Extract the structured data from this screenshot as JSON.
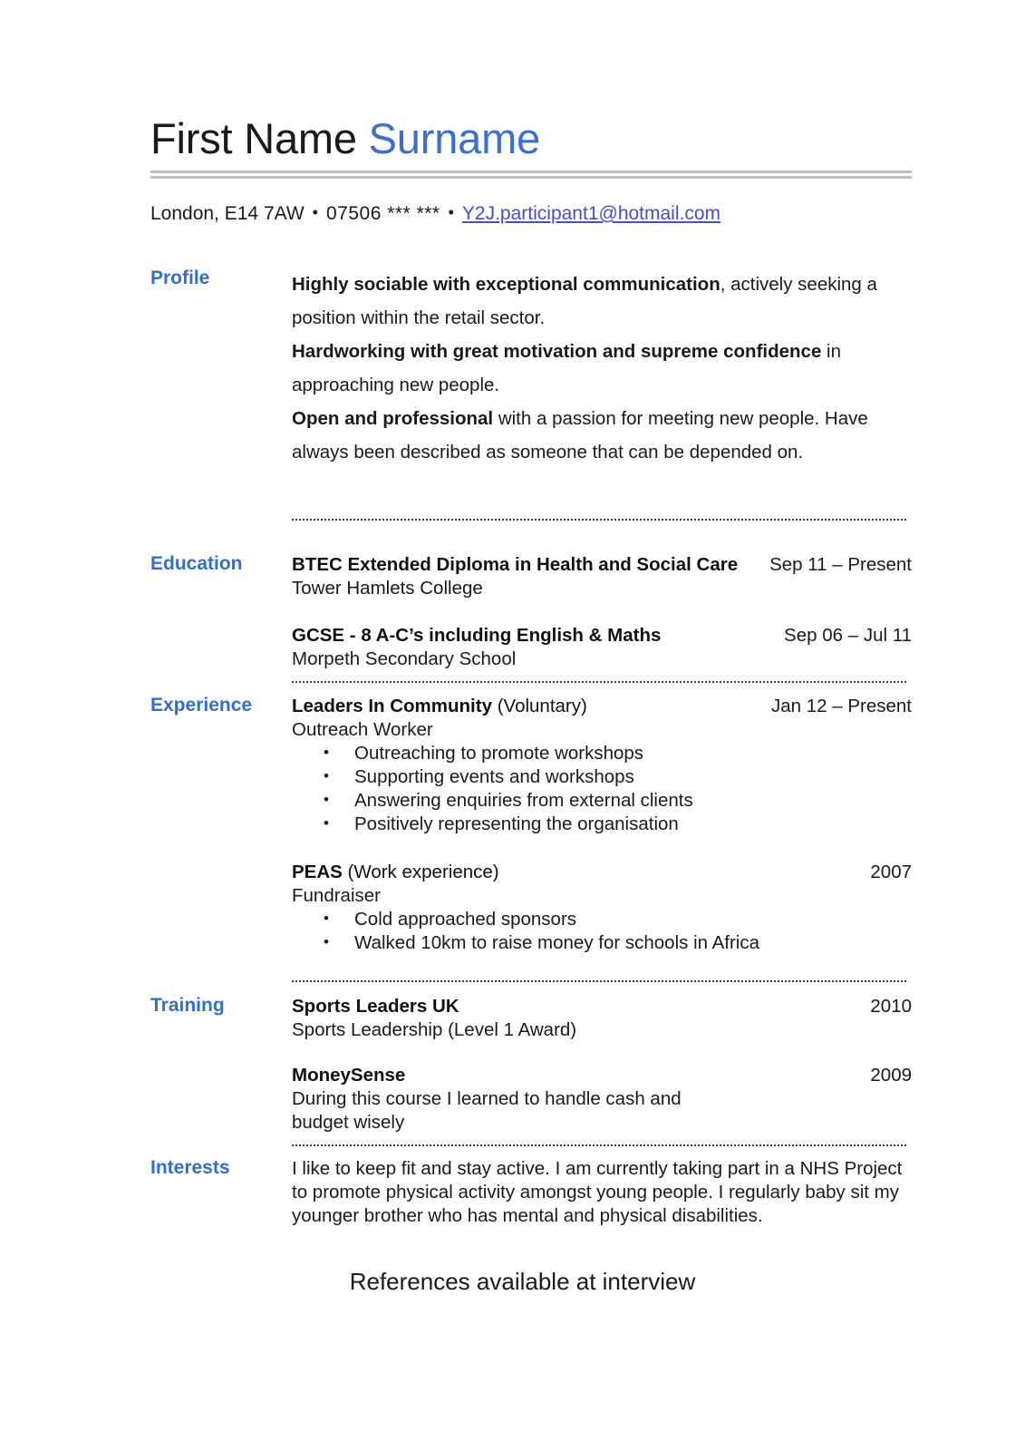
{
  "header": {
    "first_name": "First Name ",
    "surname": "Surname",
    "location": "London, E14 7AW",
    "separator": "•",
    "phone": "07506 *** ***",
    "email": "Y2J.participant1@hotmail.com"
  },
  "colors": {
    "accent_blue": "#2f6fd0",
    "name_blue": "#3b6fd4",
    "link_purple": "#4a4ad0",
    "rule_gray": "#bfbfbf",
    "text_black": "#1a1a1a"
  },
  "sections": {
    "profile": {
      "label": "Profile",
      "paragraphs": [
        {
          "bold": "Highly sociable with exceptional communication",
          "rest": ", actively seeking a position within the retail sector."
        },
        {
          "bold": "Hardworking with great motivation and supreme confidence",
          "rest": " in approaching new people."
        },
        {
          "bold": "Open and professional",
          "rest": " with a passion for meeting new people. Have always been described as someone that can be depended on."
        }
      ]
    },
    "education": {
      "label": "Education",
      "entries": [
        {
          "title": "BTEC Extended Diploma in Health and Social Care",
          "date": "Sep 11 – Present",
          "sub": "Tower Hamlets College"
        },
        {
          "title": "GCSE - 8 A-C’s including English & Maths",
          "date": "Sep 06 – Jul 11",
          "sub": "Morpeth Secondary School"
        }
      ]
    },
    "experience": {
      "label": "Experience",
      "entries": [
        {
          "title": "Leaders In Community",
          "title_light": " (Voluntary)",
          "date": "Jan 12 – Present",
          "sub": "Outreach Worker",
          "bullets": [
            "Outreaching to promote workshops",
            "Supporting events and workshops",
            "Answering enquiries from external clients",
            "Positively representing the organisation"
          ]
        },
        {
          "title": "PEAS",
          "title_light": " (Work experience)",
          "date": "2007",
          "sub": "Fundraiser",
          "bullets": [
            "Cold approached sponsors",
            "Walked 10km to raise money for schools in Africa"
          ]
        }
      ]
    },
    "training": {
      "label": "Training",
      "entries": [
        {
          "title": "Sports Leaders UK",
          "date": "2010",
          "sub": "Sports Leadership (Level 1 Award)"
        },
        {
          "title": "MoneySense",
          "date": "2009",
          "sub": "During this course I learned to handle cash and budget wisely"
        }
      ]
    },
    "interests": {
      "label": "Interests",
      "text": "I like to keep fit and stay active. I am currently taking part in a NHS Project to promote physical activity amongst young people. I regularly baby sit my younger brother who has mental and physical disabilities."
    }
  },
  "footer": {
    "note": "References available at interview"
  }
}
